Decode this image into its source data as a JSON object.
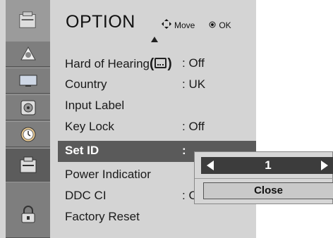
{
  "menu": {
    "title": "OPTION",
    "hint_move": "Move",
    "hint_ok": "OK",
    "items": [
      {
        "label_main": "Hard of Hearing",
        "paren_open": "(",
        "paren_close": ")",
        "value": ": Off",
        "icon": "hard-of-hearing-icon"
      },
      {
        "label": "Country",
        "value": ": UK"
      },
      {
        "label": "Input Label",
        "value": ""
      },
      {
        "label": "Key Lock",
        "value": ": Off"
      },
      {
        "label": "Set ID",
        "value": ":",
        "selected": true
      },
      {
        "label": "Power Indicatior",
        "value": ""
      },
      {
        "label": "DDC CI",
        "value": ": Off"
      },
      {
        "label": "Factory Reset",
        "value": ""
      }
    ]
  },
  "sidebar": {
    "items": [
      {
        "icon": "option-category-icon"
      },
      {
        "icon": "picture-icon"
      },
      {
        "icon": "screen-icon"
      },
      {
        "icon": "audio-icon"
      },
      {
        "icon": "time-icon"
      },
      {
        "icon": "option-icon",
        "active": true
      },
      {
        "icon": "lock-icon"
      }
    ]
  },
  "popup": {
    "set_id_value": "1",
    "close_label": "Close"
  }
}
